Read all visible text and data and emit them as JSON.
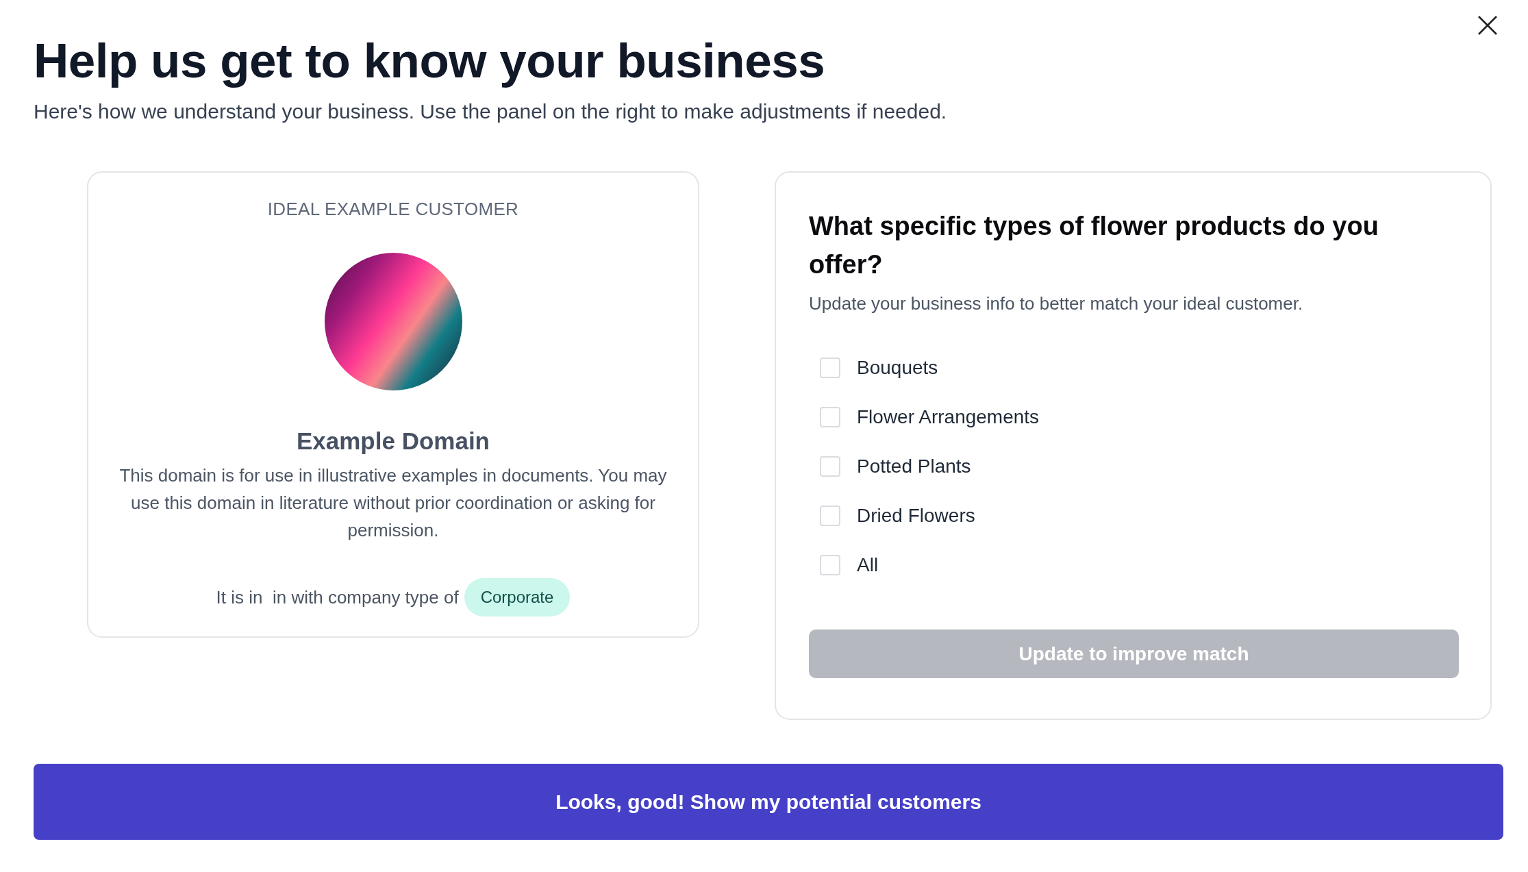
{
  "title": "Help us get to know your business",
  "subtitle": "Here's how we understand your business. Use the panel on the right to make adjustments if needed.",
  "customer_card": {
    "heading": "IDEAL EXAMPLE CUSTOMER",
    "name": "Example Domain",
    "description": "This domain is for use in illustrative examples in documents. You may use this domain in literature without prior coordination or asking for permission.",
    "company_line": "It is in  in with company type of",
    "company_type": "Corporate"
  },
  "question_panel": {
    "question": "What specific types of flower products do you offer?",
    "hint": "Update your business info to better match your ideal customer.",
    "options": [
      {
        "label": "Bouquets",
        "checked": false
      },
      {
        "label": "Flower Arrangements",
        "checked": false
      },
      {
        "label": "Potted Plants",
        "checked": false
      },
      {
        "label": "Dried Flowers",
        "checked": false
      },
      {
        "label": "All",
        "checked": false
      }
    ],
    "update_button": {
      "label": "Update to improve match",
      "disabled": true
    }
  },
  "confirm_button": "Looks, good! Show my potential customers"
}
